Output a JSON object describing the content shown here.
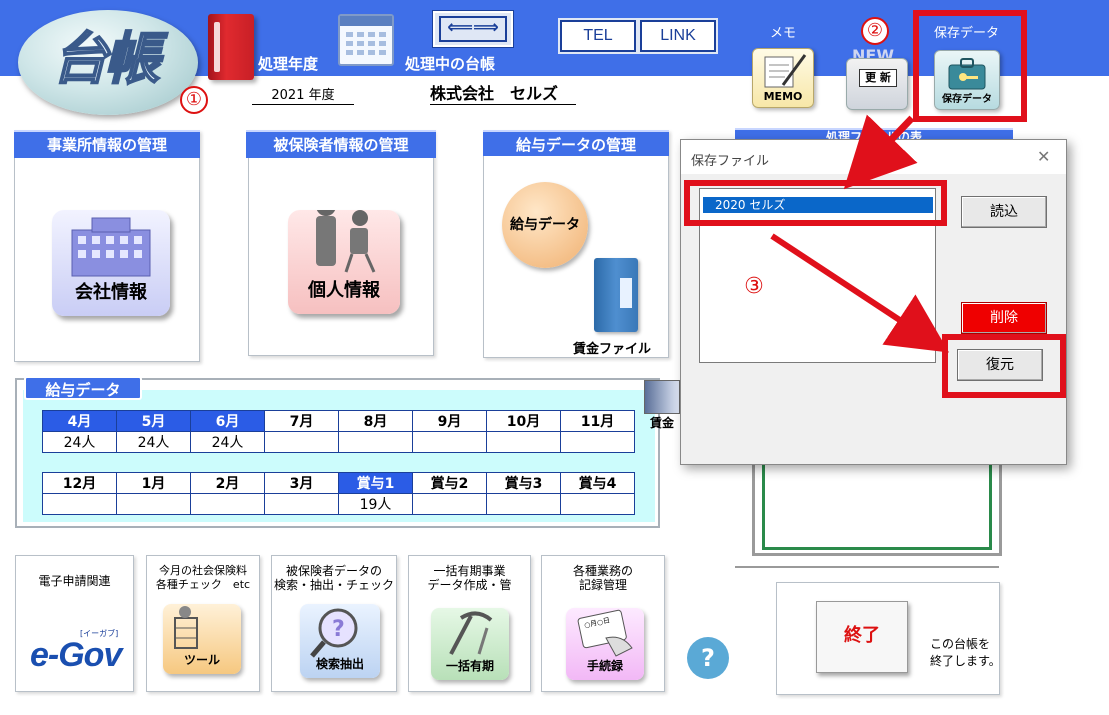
{
  "header": {
    "logo_text": "台帳",
    "fiscal_year_label": "処理年度",
    "current_ledger_label": "処理中の台帳",
    "fiscal_year_value": "2021 年度",
    "company_name": "株式会社　セルズ",
    "arrow_button": "⟸⟹",
    "tel_button": "TEL",
    "link_button": "LINK",
    "memo_caption": "メモ",
    "memo_tile_label": "MEMO",
    "update_tile_label": "更 新",
    "update_tile_badge": "NEW",
    "save_caption": "保存データ",
    "save_tile_label": "保存データ",
    "step1": "①",
    "step2": "②"
  },
  "sections": {
    "office": {
      "title": "事業所情報の管理",
      "icon_label": "会社情報"
    },
    "insured": {
      "title": "被保険者情報の管理",
      "icon_label": "個人情報"
    },
    "salary": {
      "title": "給与データの管理",
      "icon_label": "給与データ",
      "file_label": "賃金ファイル"
    },
    "hidden_title": "処理ファイルの表"
  },
  "salary_table": {
    "tab_label": "給与データ",
    "row1_months": [
      "4月",
      "5月",
      "6月",
      "7月",
      "8月",
      "9月",
      "10月",
      "11月"
    ],
    "row1_values": [
      "24人",
      "24人",
      "24人",
      "",
      "",
      "",
      "",
      ""
    ],
    "row2_months": [
      "12月",
      "1月",
      "2月",
      "3月",
      "賞与1",
      "賞与2",
      "賞与3",
      "賞与4"
    ],
    "row2_values": [
      "",
      "",
      "",
      "",
      "19人",
      "",
      "",
      ""
    ],
    "peek_label": "賃金"
  },
  "bottom_tiles": [
    {
      "caption": "電子申請関連",
      "icon_label": "e-Gov",
      "sub": "[イーガブ]"
    },
    {
      "caption": "今月の社会保険料\n各種チェック　etc",
      "icon_label": "ツール"
    },
    {
      "caption": "被保険者データの\n検索・抽出・チェック",
      "icon_label": "検索抽出"
    },
    {
      "caption": "一括有期事業\nデータ作成・管",
      "icon_label": "一括有期"
    },
    {
      "caption": "各種業務の\n記録管理",
      "icon_label": "手続録",
      "badge": "○月○日"
    }
  ],
  "help": {
    "label": "?"
  },
  "end": {
    "button": "終了",
    "desc_line1": "この台帳を",
    "desc_line2": "終了します。"
  },
  "dialog": {
    "title": "保存ファイル",
    "close": "✕",
    "list_items": [
      "2020 セルズ"
    ],
    "load_button": "読込",
    "delete_button": "削除",
    "restore_button": "復元",
    "step3": "③"
  },
  "colors": {
    "header_blue": "#3f6fe8",
    "annotation_red": "#e0101b",
    "selected_blue": "#2b5ce6"
  }
}
